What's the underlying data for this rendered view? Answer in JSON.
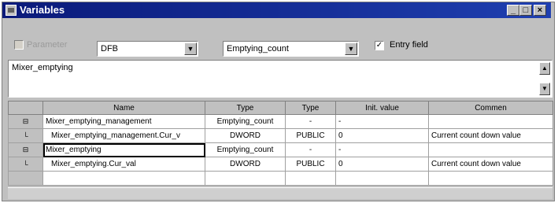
{
  "window": {
    "title": "Variables",
    "min": "_",
    "max": "□",
    "close": "×"
  },
  "toolbar": {
    "parameter_label": "Parameter",
    "type_combo": "DFB",
    "instance_combo": "Emptying_count",
    "entry_field_label": "Entry field",
    "entry_field_checked": "✓",
    "combo_arrow": "▼"
  },
  "editor": {
    "text": "Mixer_emptying",
    "scroll_up": "▲",
    "scroll_down": "▼"
  },
  "table": {
    "headers": [
      "",
      "Name",
      "Type",
      "Type",
      "Init. value",
      "Commen"
    ],
    "rows": [
      {
        "marker": "⊟",
        "name": "Mixer_emptying_management",
        "type": "Emptying_count",
        "scope": "-",
        "init": "-",
        "comment": ""
      },
      {
        "marker": "└",
        "name": "Mixer_emptying_management.Cur_v",
        "type": "DWORD",
        "scope": "PUBLIC",
        "init": "0",
        "comment": "Current count down value"
      },
      {
        "marker": "⊟",
        "name": "Mixer_emptying",
        "type": "Emptying_count",
        "scope": "-",
        "init": "-",
        "comment": ""
      },
      {
        "marker": "└",
        "name": "Mixer_emptying.Cur_val",
        "type": "DWORD",
        "scope": "PUBLIC",
        "init": "0",
        "comment": "Current count down value"
      },
      {
        "marker": "",
        "name": "",
        "type": "",
        "scope": "",
        "init": "",
        "comment": ""
      }
    ]
  }
}
